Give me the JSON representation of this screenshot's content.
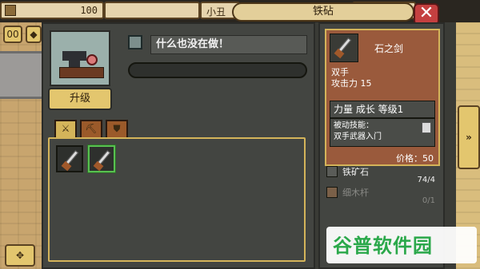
{
  "top_bar": {
    "resource_1_value": "100",
    "resource_2_label": "小丑",
    "title": "铁砧",
    "close_label": "✕"
  },
  "side_buttons": {
    "left_top_1": "00",
    "left_top_2": "◆",
    "left_bottom": "✥",
    "right_arrow": "»"
  },
  "craft": {
    "status_text": "什么也没在做！",
    "upgrade_label": "升级",
    "progress": 0,
    "tabs": [
      {
        "icon": "sword-icon",
        "glyph": "⚔"
      },
      {
        "icon": "axe-icon",
        "glyph": "⛏"
      },
      {
        "icon": "shield-icon",
        "glyph": "⛊"
      }
    ]
  },
  "detail": {
    "name": "石之剑",
    "type": "双手",
    "attack": "攻击力 15",
    "level_line": "力量 成长 等级1",
    "skill_title": "被动技能：",
    "skill_name": "双手武器入门",
    "price": "价格：50"
  },
  "materials": [
    {
      "name": "铁矿石",
      "count": "74/4",
      "dim": false
    },
    {
      "name": "细木杆",
      "count": "0/1",
      "dim": true
    }
  ],
  "watermark": {
    "text": "谷普软件园"
  },
  "colors": {
    "accent_gold": "#d4b45a",
    "close_red": "#c54040",
    "selected_green": "#58c050"
  }
}
